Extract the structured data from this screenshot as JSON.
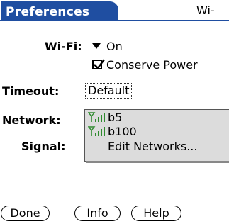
{
  "colors": {
    "accent": "#1f4ea1",
    "signal_icon": "#2e8a2e"
  },
  "titlebar": {
    "title": "Preferences",
    "right_text": "Wi-"
  },
  "wifi": {
    "label": "Wi-Fi:",
    "value": "On",
    "conserve_power_label": "Conserve Power",
    "conserve_power_checked": true
  },
  "timeout": {
    "label": "Timeout:",
    "value": "Default"
  },
  "network": {
    "label": "Network:"
  },
  "signal": {
    "label": "Signal:"
  },
  "network_popup": {
    "items": [
      {
        "label": "b5",
        "icon": "wifi-signal-icon"
      },
      {
        "label": "b100",
        "icon": "wifi-signal-icon"
      },
      {
        "label": "Edit Networks..."
      }
    ]
  },
  "buttons": {
    "done": "Done",
    "info": "Info",
    "help": "Help"
  }
}
